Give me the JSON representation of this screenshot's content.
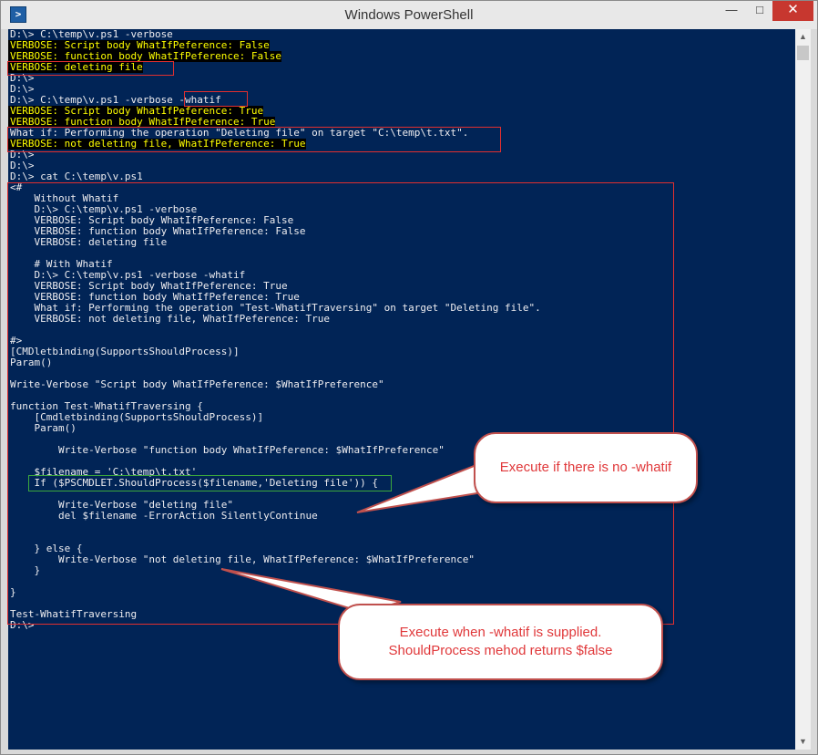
{
  "window": {
    "title": "Windows PowerShell",
    "icon": "powershell-icon",
    "controls": {
      "minimize": "—",
      "maximize": "□",
      "close": "✕"
    }
  },
  "console": {
    "background": "#012456",
    "lines": [
      {
        "text": "D:\\> C:\\temp\\v.ps1 -verbose",
        "kind": "normal"
      },
      {
        "text": "VERBOSE: Script body WhatIfPeference: False",
        "kind": "verbose"
      },
      {
        "text": "VERBOSE: function body WhatIfPeference: False",
        "kind": "verbose"
      },
      {
        "text": "VERBOSE: deleting file",
        "kind": "verbose"
      },
      {
        "text": "D:\\>",
        "kind": "normal"
      },
      {
        "text": "D:\\>",
        "kind": "normal"
      },
      {
        "text": "D:\\> C:\\temp\\v.ps1 -verbose -whatif",
        "kind": "normal"
      },
      {
        "text": "VERBOSE: Script body WhatIfPeference: True",
        "kind": "verbose"
      },
      {
        "text": "VERBOSE: function body WhatIfPeference: True",
        "kind": "verbose"
      },
      {
        "text": "What if: Performing the operation \"Deleting file\" on target \"C:\\temp\\t.txt\".",
        "kind": "normal"
      },
      {
        "text": "VERBOSE: not deleting file, WhatIfPeference: True",
        "kind": "verbose"
      },
      {
        "text": "D:\\>",
        "kind": "normal"
      },
      {
        "text": "D:\\>",
        "kind": "normal"
      },
      {
        "text": "D:\\> cat C:\\temp\\v.ps1",
        "kind": "normal"
      },
      {
        "text": "<#",
        "kind": "normal"
      },
      {
        "text": "    Without Whatif",
        "kind": "normal"
      },
      {
        "text": "    D:\\> C:\\temp\\v.ps1 -verbose",
        "kind": "normal"
      },
      {
        "text": "    VERBOSE: Script body WhatIfPeference: False",
        "kind": "normal"
      },
      {
        "text": "    VERBOSE: function body WhatIfPeference: False",
        "kind": "normal"
      },
      {
        "text": "    VERBOSE: deleting file",
        "kind": "normal"
      },
      {
        "text": "",
        "kind": "normal"
      },
      {
        "text": "    # With Whatif",
        "kind": "normal"
      },
      {
        "text": "    D:\\> C:\\temp\\v.ps1 -verbose -whatif",
        "kind": "normal"
      },
      {
        "text": "    VERBOSE: Script body WhatIfPeference: True",
        "kind": "normal"
      },
      {
        "text": "    VERBOSE: function body WhatIfPeference: True",
        "kind": "normal"
      },
      {
        "text": "    What if: Performing the operation \"Test-WhatifTraversing\" on target \"Deleting file\".",
        "kind": "normal"
      },
      {
        "text": "    VERBOSE: not deleting file, WhatIfPeference: True",
        "kind": "normal"
      },
      {
        "text": "",
        "kind": "normal"
      },
      {
        "text": "#>",
        "kind": "normal"
      },
      {
        "text": "[CMDletbinding(SupportsShouldProcess)]",
        "kind": "normal"
      },
      {
        "text": "Param()",
        "kind": "normal"
      },
      {
        "text": "",
        "kind": "normal"
      },
      {
        "text": "Write-Verbose \"Script body WhatIfPeference: $WhatIfPreference\"",
        "kind": "normal"
      },
      {
        "text": "",
        "kind": "normal"
      },
      {
        "text": "function Test-WhatifTraversing {",
        "kind": "normal"
      },
      {
        "text": "    [Cmdletbinding(SupportsShouldProcess)]",
        "kind": "normal"
      },
      {
        "text": "    Param()",
        "kind": "normal"
      },
      {
        "text": "",
        "kind": "normal"
      },
      {
        "text": "        Write-Verbose \"function body WhatIfPeference: $WhatIfPreference\"",
        "kind": "normal"
      },
      {
        "text": "",
        "kind": "normal"
      },
      {
        "text": "    $filename = 'C:\\temp\\t.txt'",
        "kind": "normal"
      },
      {
        "text": "    If ($PSCMDLET.ShouldProcess($filename,'Deleting file')) {",
        "kind": "normal"
      },
      {
        "text": "",
        "kind": "normal"
      },
      {
        "text": "        Write-Verbose \"deleting file\"",
        "kind": "normal"
      },
      {
        "text": "        del $filename -ErrorAction SilentlyContinue",
        "kind": "normal"
      },
      {
        "text": "",
        "kind": "normal"
      },
      {
        "text": "",
        "kind": "normal"
      },
      {
        "text": "    } else {",
        "kind": "normal"
      },
      {
        "text": "        Write-Verbose \"not deleting file, WhatIfPeference: $WhatIfPreference\"",
        "kind": "normal"
      },
      {
        "text": "    }",
        "kind": "normal"
      },
      {
        "text": "",
        "kind": "normal"
      },
      {
        "text": "}",
        "kind": "normal"
      },
      {
        "text": "",
        "kind": "normal"
      },
      {
        "text": "Test-WhatifTraversing",
        "kind": "normal"
      },
      {
        "text": "D:\\>",
        "kind": "normal"
      }
    ]
  },
  "callouts": {
    "no_whatif": "Execute if there is no -whatif",
    "whatif_line1": "Execute when -whatif is supplied.",
    "whatif_line2": "ShouldProcess mehod returns $false"
  },
  "annotation_colors": {
    "box": "#e02f2f",
    "green_box": "#3ca83c",
    "callout_text": "#e0383a"
  }
}
